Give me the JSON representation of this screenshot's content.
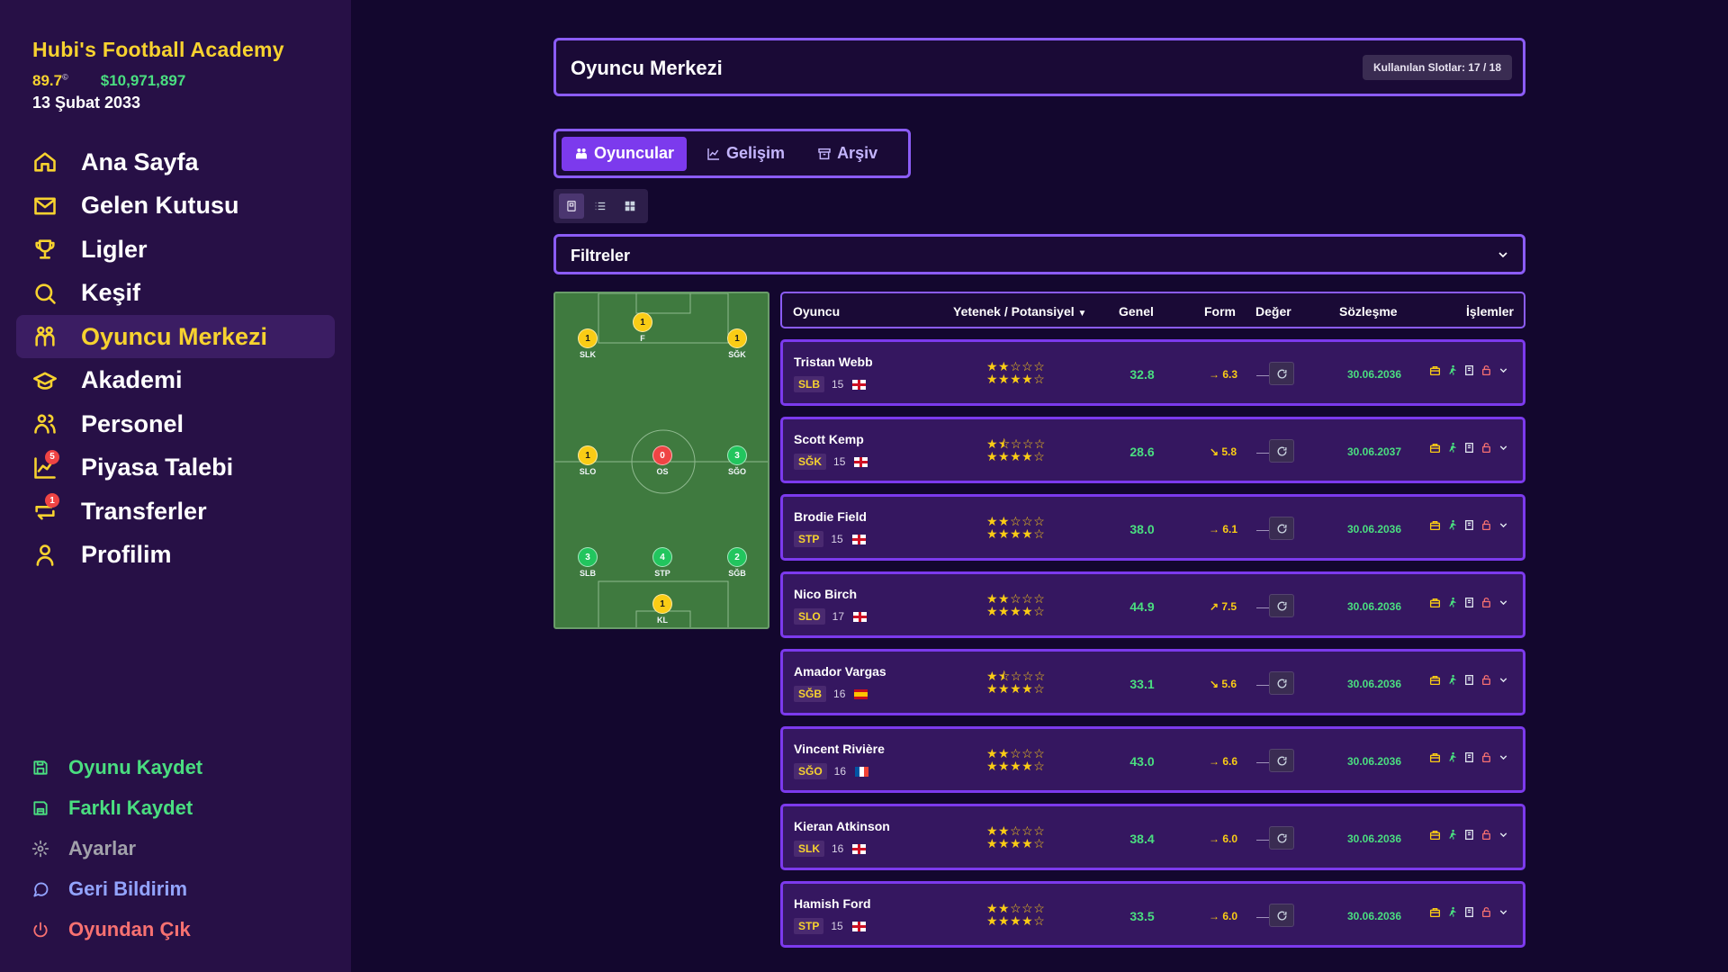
{
  "club": {
    "name": "Hubi's Football Academy",
    "rating": "89.7",
    "rating_mark": "©",
    "money": "$10,971,897",
    "date": "13 Şubat 2033"
  },
  "nav": [
    {
      "label": "Ana Sayfa",
      "icon": "home-icon"
    },
    {
      "label": "Gelen Kutusu",
      "icon": "mail-icon"
    },
    {
      "label": "Ligler",
      "icon": "trophy-icon"
    },
    {
      "label": "Keşif",
      "icon": "search-icon"
    },
    {
      "label": "Oyuncu Merkezi",
      "icon": "players-icon",
      "active": true
    },
    {
      "label": "Akademi",
      "icon": "graduation-cap-icon"
    },
    {
      "label": "Personel",
      "icon": "staff-icon"
    },
    {
      "label": "Piyasa Talebi",
      "icon": "chart-icon",
      "badge": "5"
    },
    {
      "label": "Transferler",
      "icon": "transfer-icon",
      "badge": "1"
    },
    {
      "label": "Profilim",
      "icon": "user-icon"
    }
  ],
  "bottom_nav": [
    {
      "label": "Oyunu Kaydet",
      "icon": "save-icon",
      "color": "#4ade80"
    },
    {
      "label": "Farklı Kaydet",
      "icon": "save-as-icon",
      "color": "#4ade80"
    },
    {
      "label": "Ayarlar",
      "icon": "gear-icon",
      "color": "#a1a1aa"
    },
    {
      "label": "Geri Bildirim",
      "icon": "chat-icon",
      "color": "#93a4ff"
    },
    {
      "label": "Oyundan Çık",
      "icon": "power-icon",
      "color": "#f87171"
    }
  ],
  "header": {
    "title": "Oyuncu Merkezi",
    "slots": "Kullanılan Slotlar: 17 / 18"
  },
  "tabs": [
    {
      "label": "Oyuncular",
      "active": true
    },
    {
      "label": "Gelişim"
    },
    {
      "label": "Arşiv"
    }
  ],
  "filters": {
    "label": "Filtreler"
  },
  "pitch": [
    {
      "label": "F",
      "count": "1",
      "color": "y"
    },
    {
      "label": "SLK",
      "count": "1",
      "color": "y"
    },
    {
      "label": "SĞK",
      "count": "1",
      "color": "y"
    },
    {
      "label": "SLO",
      "count": "1",
      "color": "y"
    },
    {
      "label": "OS",
      "count": "0",
      "color": "r"
    },
    {
      "label": "SĞO",
      "count": "3",
      "color": "g"
    },
    {
      "label": "SLB",
      "count": "3",
      "color": "g"
    },
    {
      "label": "STP",
      "count": "4",
      "color": "g"
    },
    {
      "label": "SĞB",
      "count": "2",
      "color": "g"
    },
    {
      "label": "KL",
      "count": "1",
      "color": "y"
    }
  ],
  "table": {
    "headers": {
      "player": "Oyuncu",
      "ability": "Yetenek / Potansiyel",
      "overall": "Genel",
      "form": "Form",
      "value": "Değer",
      "contract": "Sözleşme",
      "actions": "İşlemler"
    },
    "rows": [
      {
        "name": "Tristan Webb",
        "pos": "SLB",
        "age": "15",
        "flag": "england",
        "ability": 2,
        "potential": 4,
        "overall": "32.8",
        "trend": "→",
        "form": "6.3",
        "contract": "30.06.2036"
      },
      {
        "name": "Scott Kemp",
        "pos": "SĞK",
        "age": "15",
        "flag": "england",
        "ability": 1.5,
        "potential": 4,
        "overall": "28.6",
        "trend": "↘",
        "form": "5.8",
        "contract": "30.06.2037"
      },
      {
        "name": "Brodie Field",
        "pos": "STP",
        "age": "15",
        "flag": "england",
        "ability": 2,
        "potential": 4,
        "overall": "38.0",
        "trend": "→",
        "form": "6.1",
        "contract": "30.06.2036"
      },
      {
        "name": "Nico Birch",
        "pos": "SLO",
        "age": "17",
        "flag": "england",
        "ability": 2,
        "potential": 4,
        "overall": "44.9",
        "trend": "↗",
        "form": "7.5",
        "contract": "30.06.2036"
      },
      {
        "name": "Amador Vargas",
        "pos": "SĞB",
        "age": "16",
        "flag": "spain",
        "ability": 1.5,
        "potential": 4,
        "overall": "33.1",
        "trend": "↘",
        "form": "5.6",
        "contract": "30.06.2036"
      },
      {
        "name": "Vincent Rivière",
        "pos": "SĞO",
        "age": "16",
        "flag": "france",
        "ability": 2,
        "potential": 4,
        "overall": "43.0",
        "trend": "→",
        "form": "6.6",
        "contract": "30.06.2036"
      },
      {
        "name": "Kieran Atkinson",
        "pos": "SLK",
        "age": "16",
        "flag": "england",
        "ability": 2,
        "potential": 4,
        "overall": "38.4",
        "trend": "→",
        "form": "6.0",
        "contract": "30.06.2036"
      },
      {
        "name": "Hamish Ford",
        "pos": "STP",
        "age": "15",
        "flag": "england",
        "ability": 2,
        "potential": 4,
        "overall": "33.5",
        "trend": "→",
        "form": "6.0",
        "contract": "30.06.2036"
      }
    ]
  },
  "value_dash": "—"
}
